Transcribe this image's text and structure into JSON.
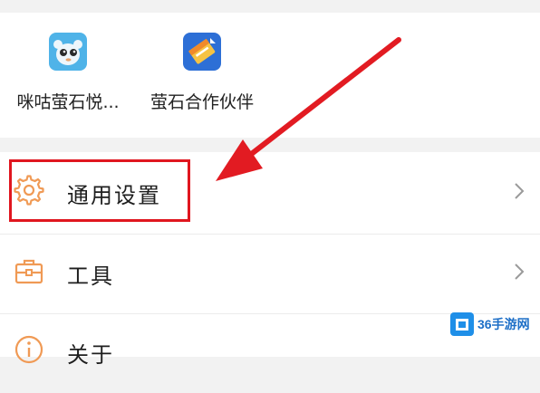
{
  "apps": [
    {
      "label": "咪咕萤石悦...",
      "icon": "migu-app-icon"
    },
    {
      "label": "萤石合作伙伴",
      "icon": "partner-app-icon"
    }
  ],
  "menu": [
    {
      "label": "通用设置",
      "icon": "gear-icon"
    },
    {
      "label": "工具",
      "icon": "toolbox-icon"
    },
    {
      "label": "关于",
      "icon": "info-icon"
    }
  ],
  "annotation": {
    "highlight_color": "#e0161f",
    "arrow_color": "#e21b22"
  },
  "watermark": {
    "text": "36手游网"
  }
}
